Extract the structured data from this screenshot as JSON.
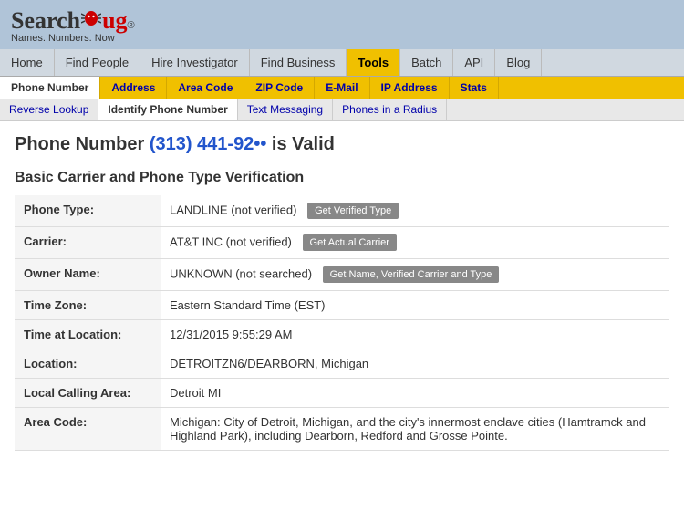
{
  "header": {
    "brand": "SearchBug",
    "tagline": "Names. Numbers. Now",
    "reg_symbol": "®"
  },
  "main_nav": {
    "items": [
      {
        "label": "Home",
        "active": false
      },
      {
        "label": "Find People",
        "active": false
      },
      {
        "label": "Hire Investigator",
        "active": false
      },
      {
        "label": "Find Business",
        "active": false
      },
      {
        "label": "Tools",
        "active": true
      },
      {
        "label": "Batch",
        "active": false
      },
      {
        "label": "API",
        "active": false
      },
      {
        "label": "Blog",
        "active": false
      }
    ]
  },
  "sub_nav1": {
    "items": [
      {
        "label": "Phone Number",
        "active": true
      },
      {
        "label": "Address",
        "active": false
      },
      {
        "label": "Area Code",
        "active": false
      },
      {
        "label": "ZIP Code",
        "active": false
      },
      {
        "label": "E-Mail",
        "active": false
      },
      {
        "label": "IP Address",
        "active": false
      },
      {
        "label": "Stats",
        "active": false
      }
    ]
  },
  "sub_nav2": {
    "items": [
      {
        "label": "Reverse Lookup",
        "active": false
      },
      {
        "label": "Identify Phone Number",
        "active": true
      },
      {
        "label": "Text Messaging",
        "active": false
      },
      {
        "label": "Phones in a Radius",
        "active": false
      }
    ]
  },
  "page": {
    "title_prefix": "Phone Number",
    "phone_number": "(313) 441-92",
    "phone_masked": "••",
    "title_suffix": "is Valid",
    "section_title": "Basic Carrier and Phone Type Verification",
    "rows": [
      {
        "label": "Phone Type:",
        "value": "LANDLINE (not verified)",
        "button": "Get Verified Type"
      },
      {
        "label": "Carrier:",
        "value": "AT&T INC (not verified)",
        "button": "Get Actual Carrier"
      },
      {
        "label": "Owner Name:",
        "value": "UNKNOWN (not searched)",
        "button": "Get Name, Verified Carrier and Type"
      },
      {
        "label": "Time Zone:",
        "value": "Eastern Standard Time (EST)",
        "button": null
      },
      {
        "label": "Time at Location:",
        "value": "12/31/2015 9:55:29 AM",
        "button": null
      },
      {
        "label": "Location:",
        "value": "DETROITZN6/DEARBORN, Michigan",
        "button": null
      },
      {
        "label": "Local Calling Area:",
        "value": "Detroit MI",
        "button": null
      },
      {
        "label": "Area Code:",
        "value": "Michigan: City of Detroit, Michigan, and the city's innermost enclave cities (Hamtramck and Highland Park), including Dearborn, Redford and Grosse Pointe.",
        "button": null
      }
    ]
  }
}
